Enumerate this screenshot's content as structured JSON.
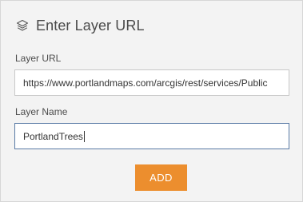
{
  "header": {
    "icon": "layers-icon",
    "title": "Enter Layer URL"
  },
  "layer_url": {
    "label": "Layer URL",
    "value": "https://www.portlandmaps.com/arcgis/rest/services/Public"
  },
  "layer_name": {
    "label": "Layer Name",
    "value": "PortlandTrees"
  },
  "add_button": {
    "label": "ADD"
  },
  "colors": {
    "panel_background": "#f3f3f3",
    "button_accent": "#ec8e2e",
    "focused_border": "#5a7ba6",
    "text": "#4a4a4a"
  }
}
